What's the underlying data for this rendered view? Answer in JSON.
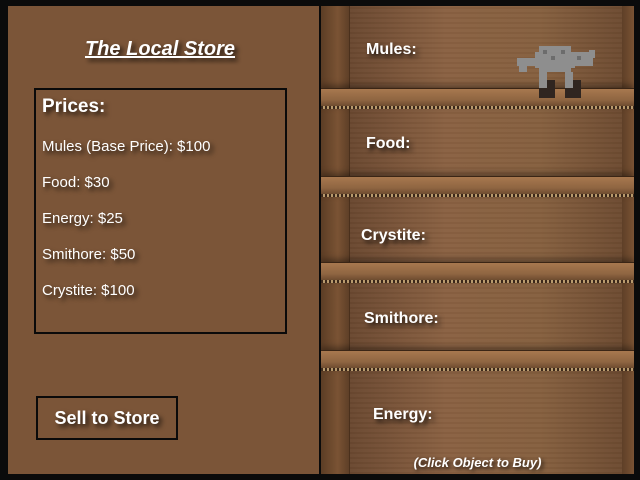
{
  "store": {
    "title": "The Local Store",
    "prices_heading": "Prices:",
    "prices": [
      "Mules (Base Price): $100",
      "Food: $30",
      "Energy: $25",
      "Smithore: $50",
      "Crystite: $100"
    ],
    "sell_button": "Sell to Store"
  },
  "shelves": [
    {
      "label": "Mules:",
      "icon": "mule-icon"
    },
    {
      "label": "Food:"
    },
    {
      "label": "Crystite:"
    },
    {
      "label": "Smithore:"
    },
    {
      "label": "Energy:"
    }
  ],
  "footer_hint": "(Click Object to Buy)",
  "colors": {
    "panel_brown": "#7b5538",
    "shelf_wood": "#8f6541",
    "mule_gray": "#8c8c8c",
    "text": "#ffffff"
  }
}
